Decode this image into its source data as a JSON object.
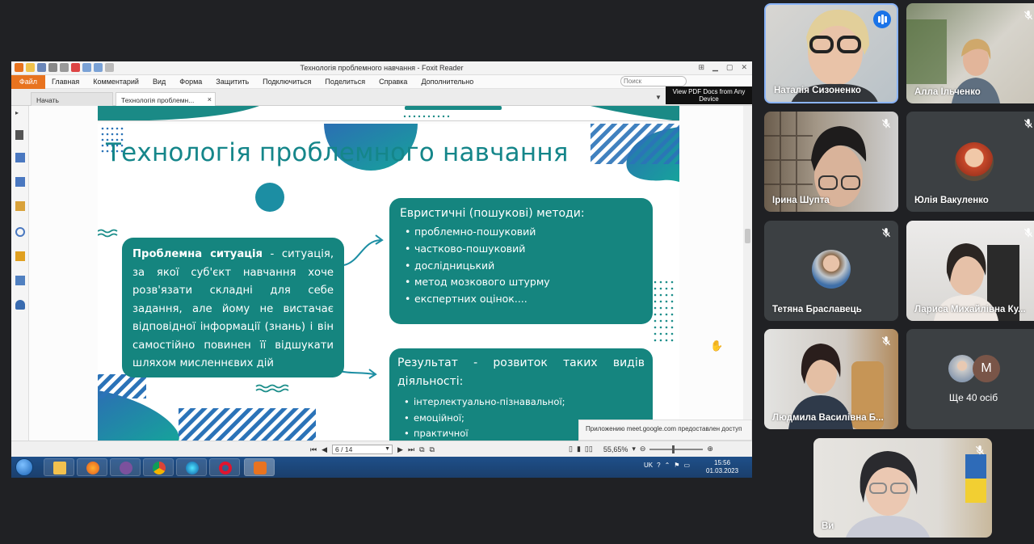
{
  "app": {
    "window_title": "Технологія проблемного навчання - Foxit Reader",
    "menu": {
      "file": "Файл",
      "items": [
        "Главная",
        "Комментарий",
        "Вид",
        "Форма",
        "Защитить",
        "Подключиться",
        "Поделиться",
        "Справка",
        "Дополнительно"
      ],
      "search_placeholder": "Поиск"
    },
    "tabs": [
      {
        "label": "Начать"
      },
      {
        "label": "Технологія проблемн...",
        "close": "×"
      }
    ],
    "ad_text": "View PDF Docs from Any Device",
    "notification": "Приложению meet.google.com предоставлен доступ",
    "page_indicator": "6 / 14",
    "zoom": "55,65%",
    "tray_lang": "UK",
    "clock_time": "15:56",
    "clock_date": "01.03.2023"
  },
  "slide": {
    "title": "Технологія  проблемного навчання",
    "situation_bold": "Проблемна ситуація",
    "situation_text": " - ситуація, за якої суб'єкт навчання хоче розв'язати складні для себе задання, але йому не вистачає відповідної інформації (знань) і він самостійно повинен її відшукати шляхом мисленнєвих дій",
    "methods_heading": "Евристичні (пошукові) методи:",
    "methods": [
      "проблемно-пошуковий",
      "частково-пошуковий",
      "дослідницький",
      "метод мозкового штурму",
      "експертних оцінок...."
    ],
    "result_heading": "Результат - розвиток таких видів діяльності:",
    "results": [
      "інтерлектуально-пізнавальної;",
      "емоційної;",
      "практичної"
    ]
  },
  "participants": [
    {
      "name": "Наталія Сизоненко",
      "speaking": true
    },
    {
      "name": "Алла Ільченко",
      "muted": true
    },
    {
      "name": "Ірина Шупта",
      "muted": true
    },
    {
      "name": "Юлія Вакуленко",
      "muted": true
    },
    {
      "name": "Тетяна Браславець",
      "muted": true
    },
    {
      "name": "Лариса Михайлівна Ку...",
      "muted": true
    },
    {
      "name": "Людмила Василівна Б...",
      "muted": true
    },
    {
      "name": "Ще 40 осіб",
      "avatar_letter": "M"
    },
    {
      "name": "Ви",
      "muted": true
    }
  ],
  "colors": {
    "accent_teal": "#15857f",
    "foxit_orange": "#e8731f",
    "meet_blue": "#1a73e8",
    "meet_tile": "#3c4043",
    "background": "#202124"
  }
}
